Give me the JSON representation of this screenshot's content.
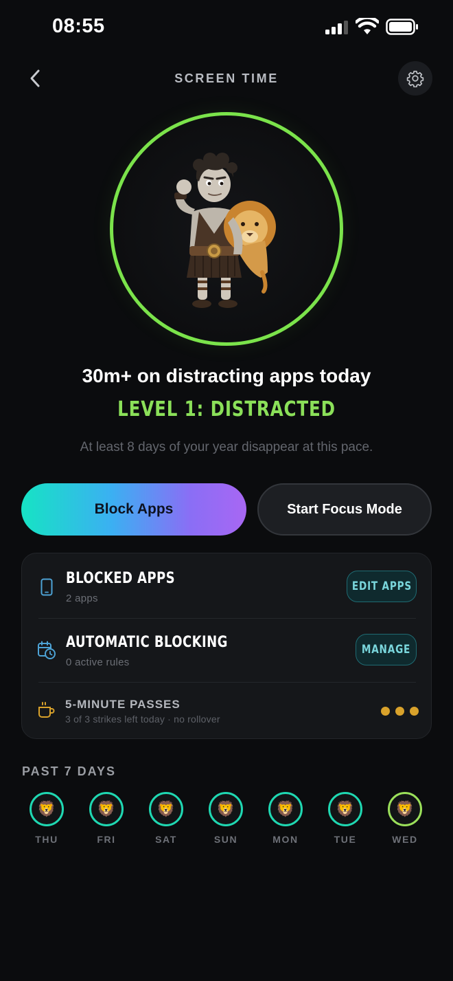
{
  "status_bar": {
    "time": "08:55"
  },
  "header": {
    "title": "SCREEN TIME"
  },
  "hero": {
    "headline": "30m+ on distracting apps today",
    "level": "LEVEL 1: DISTRACTED",
    "subtext": "At least 8 days of your year disappear at this pace."
  },
  "actions": {
    "block_apps": "Block Apps",
    "focus_mode": "Start Focus Mode"
  },
  "card": {
    "blocked_apps": {
      "title": "BLOCKED APPS",
      "subtitle": "2 apps",
      "button": "EDIT APPS"
    },
    "automatic_blocking": {
      "title": "AUTOMATIC BLOCKING",
      "subtitle": "0 active rules",
      "button": "MANAGE"
    },
    "passes": {
      "title": "5-MINUTE PASSES",
      "subtitle": "3 of 3 strikes left today · no rollover",
      "remaining": 3
    }
  },
  "past_days": {
    "label": "PAST 7 DAYS",
    "days": [
      "THU",
      "FRI",
      "SAT",
      "SUN",
      "MON",
      "TUE",
      "WED"
    ]
  },
  "colors": {
    "level_green": "#7be34b",
    "teal": "#1fd8b2",
    "pass_gold": "#d9a22b",
    "gradient_start": "#16e3c4",
    "gradient_end": "#a867f3"
  }
}
